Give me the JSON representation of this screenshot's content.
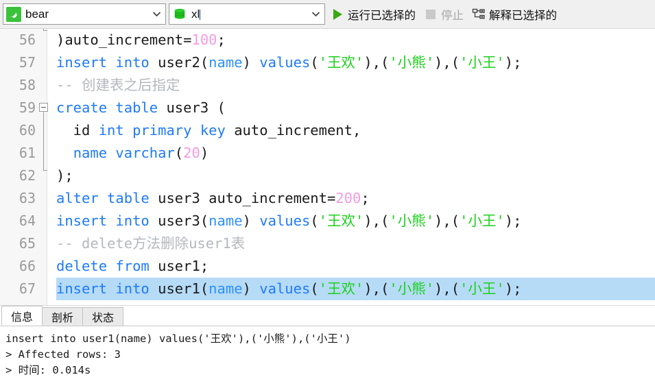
{
  "toolbar": {
    "connection": {
      "icon": "mysql-dolphin-icon",
      "value": "bear",
      "arrow_icon": "chevron-down-icon"
    },
    "database": {
      "icon": "database-icon",
      "value": "xl",
      "arrow_icon": "chevron-down-icon"
    },
    "buttons": [
      {
        "label": "运行已选择的",
        "icon": "play-icon",
        "enabled": true
      },
      {
        "label": "停止",
        "icon": "stop-icon",
        "enabled": false
      },
      {
        "label": "解释已选择的",
        "icon": "explain-plan-icon",
        "enabled": true
      }
    ]
  },
  "editor": {
    "first_line_number": 56,
    "selected_line_number": 67,
    "lines": [
      {
        "n": 56,
        "fold": "end",
        "tokens": [
          {
            "t": ")auto_increment=",
            "c": "plain"
          },
          {
            "t": "100",
            "c": "num"
          },
          {
            "t": ";",
            "c": "plain"
          }
        ]
      },
      {
        "n": 57,
        "fold": "none",
        "tokens": [
          {
            "t": "insert into",
            "c": "kw"
          },
          {
            "t": " user2(",
            "c": "plain"
          },
          {
            "t": "name",
            "c": "col"
          },
          {
            "t": ") ",
            "c": "plain"
          },
          {
            "t": "values",
            "c": "kw"
          },
          {
            "t": "(",
            "c": "plain"
          },
          {
            "t": "'王欢'",
            "c": "str"
          },
          {
            "t": "),(",
            "c": "plain"
          },
          {
            "t": "'小熊'",
            "c": "str"
          },
          {
            "t": "),(",
            "c": "plain"
          },
          {
            "t": "'小王'",
            "c": "str"
          },
          {
            "t": ");",
            "c": "plain"
          }
        ]
      },
      {
        "n": 58,
        "fold": "none",
        "tokens": [
          {
            "t": "-- 创建表之后指定",
            "c": "cmt"
          }
        ]
      },
      {
        "n": 59,
        "fold": "box",
        "tokens": [
          {
            "t": "create table",
            "c": "kw"
          },
          {
            "t": " user3 (",
            "c": "plain"
          }
        ]
      },
      {
        "n": 60,
        "fold": "line",
        "tokens": [
          {
            "t": "  id ",
            "c": "plain"
          },
          {
            "t": "int primary key",
            "c": "kw"
          },
          {
            "t": " auto_increment,",
            "c": "plain"
          }
        ]
      },
      {
        "n": 61,
        "fold": "line",
        "tokens": [
          {
            "t": "  ",
            "c": "plain"
          },
          {
            "t": "name varchar",
            "c": "kw"
          },
          {
            "t": "(",
            "c": "plain"
          },
          {
            "t": "20",
            "c": "num"
          },
          {
            "t": ")",
            "c": "plain"
          }
        ]
      },
      {
        "n": 62,
        "fold": "endtop",
        "tokens": [
          {
            "t": ");",
            "c": "plain"
          }
        ]
      },
      {
        "n": 63,
        "fold": "none",
        "tokens": [
          {
            "t": "alter table",
            "c": "kw"
          },
          {
            "t": " user3 auto_increment=",
            "c": "plain"
          },
          {
            "t": "200",
            "c": "num"
          },
          {
            "t": ";",
            "c": "plain"
          }
        ]
      },
      {
        "n": 64,
        "fold": "none",
        "tokens": [
          {
            "t": "insert into",
            "c": "kw"
          },
          {
            "t": " user3(",
            "c": "plain"
          },
          {
            "t": "name",
            "c": "col"
          },
          {
            "t": ") ",
            "c": "plain"
          },
          {
            "t": "values",
            "c": "kw"
          },
          {
            "t": "(",
            "c": "plain"
          },
          {
            "t": "'王欢'",
            "c": "str"
          },
          {
            "t": "),(",
            "c": "plain"
          },
          {
            "t": "'小熊'",
            "c": "str"
          },
          {
            "t": "),(",
            "c": "plain"
          },
          {
            "t": "'小王'",
            "c": "str"
          },
          {
            "t": ");",
            "c": "plain"
          }
        ]
      },
      {
        "n": 65,
        "fold": "none",
        "tokens": [
          {
            "t": "-- delete方法删除user1表",
            "c": "cmt"
          }
        ]
      },
      {
        "n": 66,
        "fold": "none",
        "tokens": [
          {
            "t": "delete from",
            "c": "kw"
          },
          {
            "t": " user1;",
            "c": "plain"
          }
        ]
      },
      {
        "n": 67,
        "fold": "none",
        "selected": true,
        "tokens": [
          {
            "t": "insert into",
            "c": "kw"
          },
          {
            "t": " user1(",
            "c": "plain"
          },
          {
            "t": "name",
            "c": "col"
          },
          {
            "t": ") ",
            "c": "plain"
          },
          {
            "t": "values",
            "c": "kw"
          },
          {
            "t": "(",
            "c": "plain"
          },
          {
            "t": "'王欢'",
            "c": "str"
          },
          {
            "t": "),(",
            "c": "plain"
          },
          {
            "t": "'小熊'",
            "c": "str"
          },
          {
            "t": "),(",
            "c": "plain"
          },
          {
            "t": "'小王'",
            "c": "str"
          },
          {
            "t": ");",
            "c": "plain"
          }
        ]
      }
    ]
  },
  "results": {
    "tabs": [
      {
        "label": "信息",
        "active": true
      },
      {
        "label": "剖析",
        "active": false
      },
      {
        "label": "状态",
        "active": false
      }
    ],
    "output_lines": [
      "insert into user1(name) values('王欢'),('小熊'),('小王')",
      "> Affected rows: 3",
      "> 时间: 0.014s"
    ]
  },
  "colors": {
    "keyword": "#1e7afc",
    "string": "#19d119",
    "number": "#f79ae0",
    "comment": "#b4b8bd",
    "column": "#2b90ff",
    "selection": "#b6dbf7",
    "accent_green": "#3aa814",
    "toolbar_bg": "#f0f0f0",
    "gutter_bg": "#f7f7f7"
  }
}
